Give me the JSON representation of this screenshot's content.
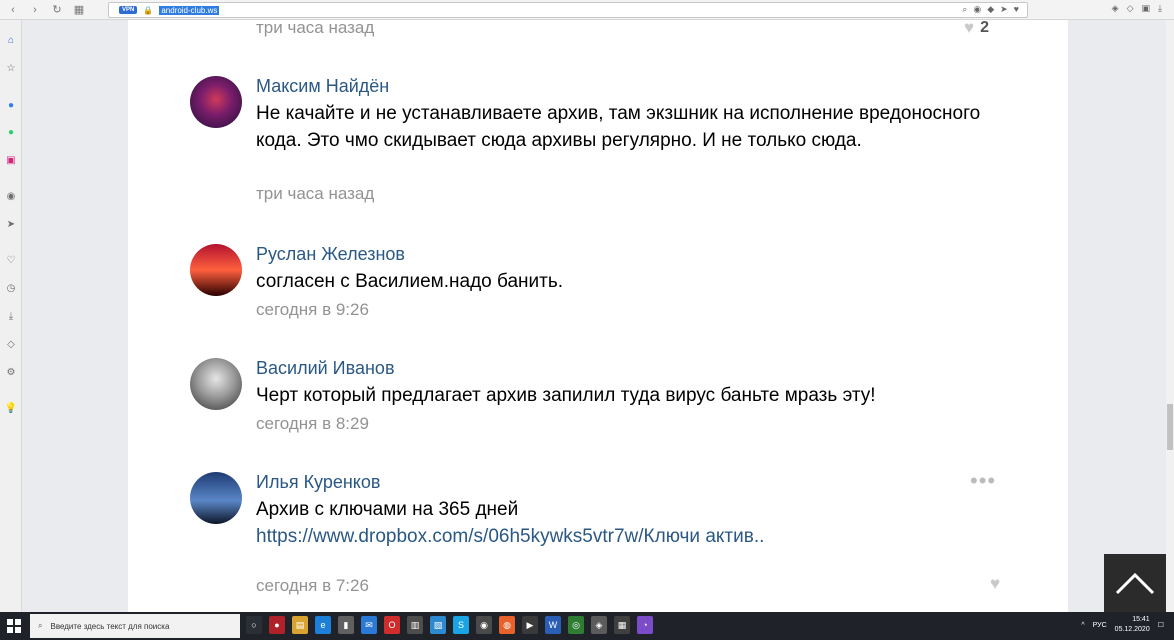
{
  "browser": {
    "vpn_badge": "VPN",
    "url": "android-club.ws"
  },
  "comments": [
    {
      "author": "",
      "text": "",
      "time": "три часа назад",
      "likes": "2",
      "avatar_colors": [
        "#ffffff",
        "#ffffff"
      ]
    },
    {
      "author": "Максим Найдён",
      "text": "Не качайте и не устанавливаете архив, там экзшник на исполнение вредоносного кода. Это чмо скидывает сюда архивы регулярно. И не только сюда.",
      "time": "три часа назад",
      "avatar_colors": [
        "#2a0f40",
        "#c2285a"
      ]
    },
    {
      "author": "Руслан Железнов",
      "text": "согласен с Василием.надо банить.",
      "time": "сегодня в 9:26",
      "avatar_colors": [
        "#b3132f",
        "#ff7a3d"
      ]
    },
    {
      "author": "Василий Иванов",
      "text": "Черт который предлагает архив запилил туда вирус баньте мразь эту!",
      "time": "сегодня в 8:29",
      "avatar_colors": [
        "#4a4a4a",
        "#d2d2d2"
      ]
    },
    {
      "author": "Илья Куренков",
      "text": "Архив с ключами на 365 дней",
      "link": "https://www.dropbox.com/s/06h5kywks5vtr7w/Ключи актив..",
      "time": "сегодня в 7:26",
      "avatar_colors": [
        "#1e3c73",
        "#9fb7d8"
      ]
    }
  ],
  "taskbar": {
    "search_placeholder": "Введите здесь текст для поиска",
    "lang": "РУС",
    "time": "15:41",
    "date": "05.12.2020"
  }
}
